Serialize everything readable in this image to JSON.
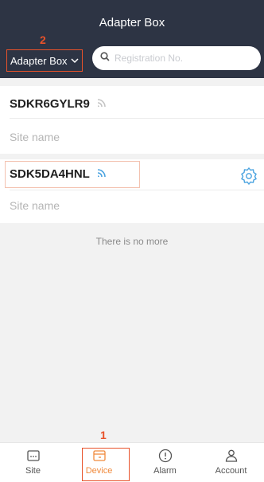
{
  "header": {
    "title": "Adapter Box",
    "filter_label": "Adapter Box",
    "search_placeholder": "Registration No."
  },
  "annotations": {
    "step1": "1",
    "step2": "2"
  },
  "devices": [
    {
      "id": "SDKR6GYLR9",
      "site": "Site name",
      "signal": "wifi-icon-gray"
    },
    {
      "id": "SDK5DA4HNL",
      "site": "Site name",
      "signal": "wifi-icon-orange"
    }
  ],
  "list_end": "There is no more",
  "tabs": [
    {
      "label": "Site",
      "icon": "site-icon",
      "active": false
    },
    {
      "label": "Device",
      "icon": "device-icon",
      "active": true
    },
    {
      "label": "Alarm",
      "icon": "alarm-icon",
      "active": false
    },
    {
      "label": "Account",
      "icon": "account-icon",
      "active": false
    }
  ],
  "colors": {
    "header_bg": "#2d3444",
    "accent": "#f08a3c",
    "annotation": "#e8522a",
    "gear": "#4aa3e0"
  }
}
